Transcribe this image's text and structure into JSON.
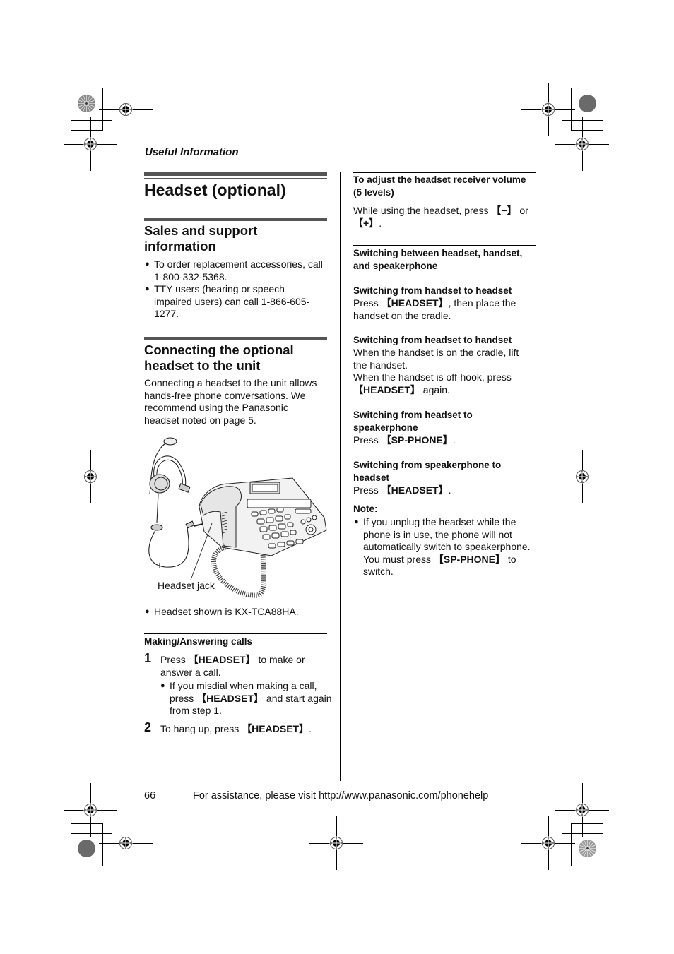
{
  "header": {
    "section": "Useful Information"
  },
  "page_title": "Headset (optional)",
  "sales": {
    "heading": "Sales and support information",
    "heading_line1": "Sales and support",
    "heading_line2": "information",
    "bullets": [
      {
        "line1": "To order replacement accessories, call",
        "line2": "1-800-332-5368."
      },
      {
        "line1": "TTY users (hearing or speech",
        "line2": "impaired users) can call 1-866-605-",
        "line3": "1277."
      }
    ]
  },
  "connecting": {
    "heading_line1": "Connecting the optional",
    "heading_line2": "headset to the unit",
    "body": [
      "Connecting a headset to the unit allows",
      "hands-free phone conversations. We",
      "recommend using the Panasonic",
      "headset noted on page 5."
    ],
    "figure_label": "Headset jack",
    "figure_note": "Headset shown is KX-TCA88HA."
  },
  "making_calls": {
    "heading": "Making/Answering calls",
    "steps": [
      {
        "number": "1",
        "pre": "Press ",
        "key": "【HEADSET】",
        "post": " to make or",
        "line2": "answer a call.",
        "sub_bullet": {
          "line1": "If you misdial when making a call,",
          "pre": "press ",
          "key": "【HEADSET】",
          "post": " and start again",
          "line3": "from step 1."
        }
      },
      {
        "number": "2",
        "pre": "To hang up, press ",
        "key": "【HEADSET】",
        "post": "."
      }
    ]
  },
  "volume": {
    "heading_line1": "To adjust the headset receiver volume",
    "heading_line2": "(5 levels)",
    "pre": "While using the headset, press ",
    "key_minus": "【−】",
    "mid": " or",
    "key_plus": "【+】",
    "post": "."
  },
  "switching": {
    "heading_line1": "Switching between headset, handset,",
    "heading_line2": "and speakerphone",
    "items": [
      {
        "title": "Switching from handset to headset",
        "pre": "Press ",
        "key": "【HEADSET】",
        "post": ", then place the",
        "line2": "handset on the cradle."
      },
      {
        "title": "Switching from headset to handset",
        "line1": "When the handset is on the cradle, lift",
        "line2": "the handset.",
        "line3": "When the handset is off-hook, press",
        "key": "【HEADSET】",
        "post": " again."
      },
      {
        "title_line1": "Switching from headset to",
        "title_line2": "speakerphone",
        "pre": "Press ",
        "key": "【SP-PHONE】",
        "post": "."
      },
      {
        "title_line1": "Switching from speakerphone to",
        "title_line2": "headset",
        "pre": "Press ",
        "key": "【HEADSET】",
        "post": "."
      }
    ]
  },
  "note": {
    "heading": "Note:",
    "line1": "If you unplug the headset while the",
    "line2": "phone is in use, the phone will not",
    "line3": "automatically switch to speakerphone.",
    "pre": "You must press ",
    "key": "【SP-PHONE】",
    "post": " to",
    "line5": "switch."
  },
  "footer": {
    "page_number": "66",
    "text": "For assistance, please visit http://www.panasonic.com/phonehelp"
  },
  "bullet_glyph": "●",
  "icons": {
    "registration_mark": "crosshair-target-icon",
    "color_wheel": "color-calibration-wheel-icon",
    "gray_disc": "gray-density-disc-icon"
  }
}
